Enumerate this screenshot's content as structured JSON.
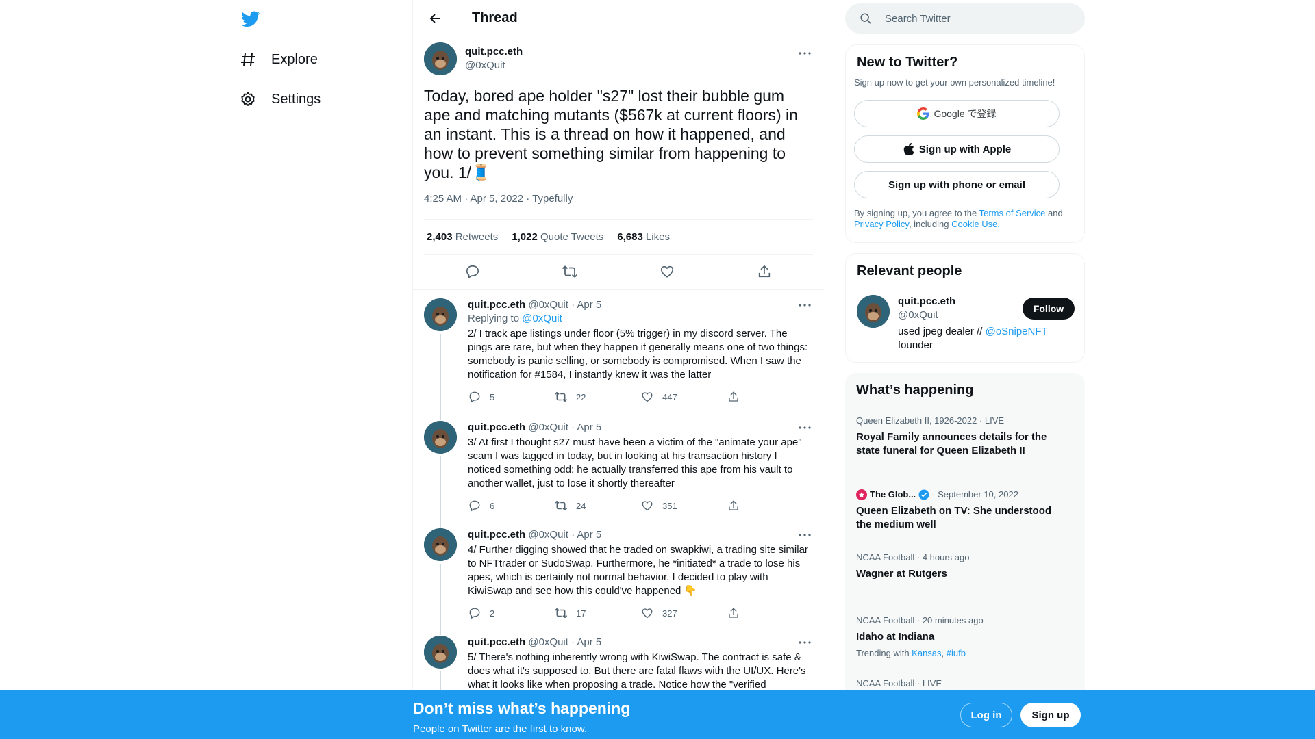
{
  "nav": {
    "explore_label": "Explore",
    "settings_label": "Settings"
  },
  "thread_header": {
    "title": "Thread"
  },
  "main_tweet": {
    "name": "quit.pcc.eth",
    "handle": "@0xQuit",
    "text": "Today, bored ape holder \"s27\" lost their bubble gum ape and matching mutants ($567k at current floors) in an instant.  This is a thread on how it happened, and how to prevent something similar from happening to you. 1/🧵",
    "meta": "4:25 AM · Apr 5, 2022 · Typefully",
    "retweets": "2,403",
    "retweets_label": "Retweets",
    "quotes": "1,022",
    "quotes_label": "Quote Tweets",
    "likes": "6,683",
    "likes_label": "Likes"
  },
  "replies": [
    {
      "name": "quit.pcc.eth",
      "handle": "@0xQuit · Apr 5",
      "replying_prefix": "Replying to ",
      "replying_to": "@0xQuit",
      "text": "2/ I track ape listings under floor (5% trigger) in my discord server.  The pings are rare, but when they happen it generally means one of two things: somebody is panic selling, or somebody is compromised.  When I saw the notification for #1584, I instantly knew it was the latter",
      "replies": "5",
      "retweets": "22",
      "likes": "447"
    },
    {
      "name": "quit.pcc.eth",
      "handle": "@0xQuit · Apr 5",
      "text": "3/ At first I thought s27 must have been a victim of the \"animate your ape\" scam I was tagged in today, but in looking at his transaction history I noticed something odd: he actually transferred this ape from his vault to another wallet, just to lose it shortly thereafter",
      "replies": "6",
      "retweets": "24",
      "likes": "351"
    },
    {
      "name": "quit.pcc.eth",
      "handle": "@0xQuit · Apr 5",
      "text": "4/ Further digging showed that he traded on swapkiwi, a trading site similar to NFTtrader or SudoSwap.  Furthermore, he *initiated* a trade to lose his apes, which is certainly not normal behavior. I decided to play with KiwiSwap and see how this could've happened 👇",
      "replies": "2",
      "retweets": "17",
      "likes": "327"
    },
    {
      "name": "quit.pcc.eth",
      "handle": "@0xQuit · Apr 5",
      "text": "5/ There's nothing inherently wrong with KiwiSwap.  The contract is safe & does what it's supposed to.  But there are fatal flaws with the UI/UX. Here's what it looks like when proposing a trade.  Notice how the \"verified"
    }
  ],
  "search": {
    "placeholder": "Search Twitter"
  },
  "new_to_twitter": {
    "title": "New to Twitter?",
    "subtitle": "Sign up now to get your own personalized timeline!",
    "google_label": "Google で登録",
    "apple_label": "Sign up with Apple",
    "phone_label": "Sign up with phone or email",
    "legal_prefix": "By signing up, you agree to the ",
    "terms": "Terms of Service",
    "and": " and ",
    "privacy": "Privacy Policy",
    "including": ", including ",
    "cookie": "Cookie Use."
  },
  "relevant_people": {
    "title": "Relevant people",
    "name": "quit.pcc.eth",
    "handle": "@0xQuit",
    "follow_label": "Follow",
    "bio_prefix": "used jpeg dealer // ",
    "bio_link": "@oSnipeNFT",
    "bio_suffix": "founder"
  },
  "whats_happening": {
    "title": "What’s happening",
    "trends": [
      {
        "context": "Queen Elizabeth II, 1926-2022 · LIVE",
        "title": "Royal Family announces details for the state funeral for Queen Elizabeth II"
      },
      {
        "source": "The Glob...",
        "context": "· September 10, 2022",
        "title": "Queen Elizabeth on TV: She understood the medium well"
      },
      {
        "context": "NCAA Football · 4 hours ago",
        "title": "Wagner at Rutgers"
      },
      {
        "context": "NCAA Football · 20 minutes ago",
        "title": "Idaho at Indiana",
        "trending_prefix": "Trending with ",
        "tag1": "Kansas",
        "sep": ", ",
        "tag2": "#iufb"
      },
      {
        "context": "NCAA Football · LIVE"
      }
    ]
  },
  "banner": {
    "title": "Don’t miss what’s happening",
    "subtitle": "People on Twitter are the first to know.",
    "login_label": "Log in",
    "signup_label": "Sign up"
  },
  "colors": {
    "accent": "#1d9bf0",
    "text": "#0f1419",
    "muted": "#536471",
    "border": "#eff3f4"
  }
}
